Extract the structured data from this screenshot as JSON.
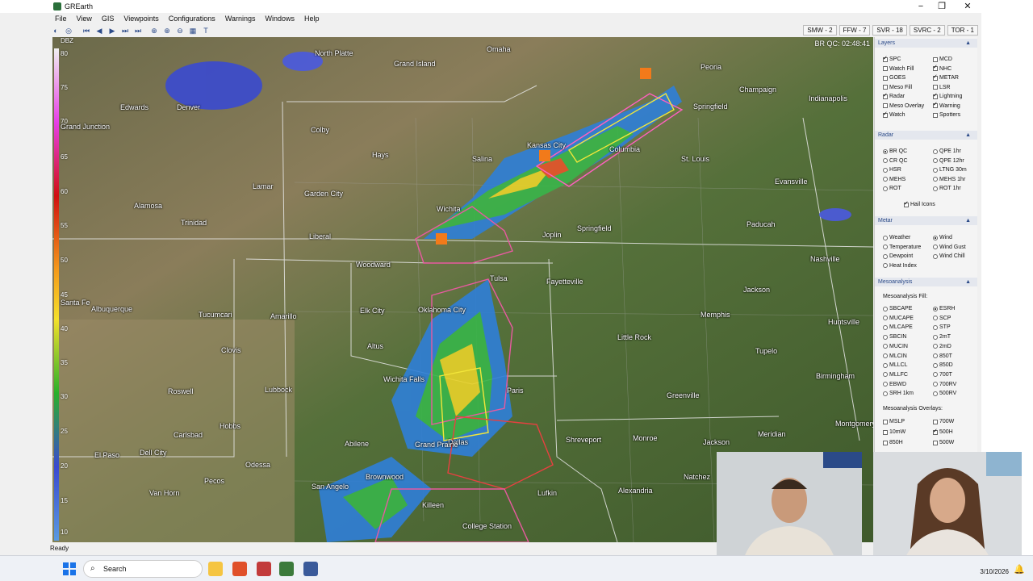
{
  "window": {
    "title": "GREarth",
    "minimize": "−",
    "maximize": "❐",
    "close": "✕"
  },
  "menu": [
    "File",
    "View",
    "GIS",
    "Viewpoints",
    "Configurations",
    "Warnings",
    "Windows",
    "Help"
  ],
  "toolbar": {
    "icons": [
      "globe-icon",
      "gps-icon",
      "first-frame-icon",
      "prev-frame-icon",
      "play-icon",
      "next-frame-icon",
      "last-frame-icon",
      "zoom-fit-icon",
      "zoom-in-icon",
      "zoom-out-icon",
      "grid-icon",
      "text-icon"
    ]
  },
  "warning_counts": [
    "SMW - 2",
    "FFW - 7",
    "SVR - 18",
    "SVRC - 2",
    "TOR - 1"
  ],
  "map": {
    "readout": "BR QC: 02:48:41",
    "scale_label": "DBZ",
    "scale_ticks": [
      "80",
      "75",
      "70",
      "65",
      "60",
      "55",
      "50",
      "45",
      "40",
      "35",
      "30",
      "25",
      "20",
      "15",
      "10"
    ],
    "cities": [
      "North Platte",
      "Grand Island",
      "Omaha",
      "Peoria",
      "Champaign",
      "Indianapolis",
      "Springfield",
      "Edwards",
      "Denver",
      "Grand Junction",
      "Colby",
      "Hays",
      "Salina",
      "Kansas City",
      "Columbia",
      "St. Louis",
      "Evansville",
      "Lamar",
      "Garden City",
      "Wichita",
      "Joplin",
      "Springfield",
      "Paducah",
      "Alamosa",
      "Trinidad",
      "Liberal",
      "Woodward",
      "Tulsa",
      "Fayetteville",
      "Nashville",
      "Jackson",
      "Santa Fe",
      "Albuquerque",
      "Tucumcari",
      "Amarillo",
      "Elk City",
      "Oklahoma City",
      "Memphis",
      "Little Rock",
      "Huntsville",
      "Clovis",
      "Altus",
      "Wichita Falls",
      "Paris",
      "Tupelo",
      "Birmingham",
      "Roswell",
      "Lubbock",
      "Hobbs",
      "Greenville",
      "Carlsbad",
      "Abilene",
      "Dallas",
      "Shreveport",
      "Monroe",
      "Jackson",
      "Meridian",
      "Montgomery",
      "El Paso",
      "Dell City",
      "Odessa",
      "Brownwood",
      "Grand Prairie",
      "Pecos",
      "San Angelo",
      "Killeen",
      "Lufkin",
      "Alexandria",
      "Natchez",
      "Van Horn",
      "College Station"
    ]
  },
  "panel": {
    "layers": {
      "title": "Layers",
      "items": [
        {
          "label": "SPC",
          "on": true
        },
        {
          "label": "MCD",
          "on": false
        },
        {
          "label": "Watch Fill",
          "on": false
        },
        {
          "label": "NHC",
          "on": true
        },
        {
          "label": "GOES",
          "on": false
        },
        {
          "label": "METAR",
          "on": true
        },
        {
          "label": "Meso Fill",
          "on": false
        },
        {
          "label": "LSR",
          "on": false
        },
        {
          "label": "Radar",
          "on": true
        },
        {
          "label": "Lightning",
          "on": true
        },
        {
          "label": "Meso Overlay",
          "on": false
        },
        {
          "label": "Warning",
          "on": true
        },
        {
          "label": "Watch",
          "on": true
        },
        {
          "label": "Spotters",
          "on": false
        }
      ]
    },
    "radar": {
      "title": "Radar",
      "items": [
        {
          "label": "BR QC",
          "on": true
        },
        {
          "label": "QPE 1hr",
          "on": false
        },
        {
          "label": "CR QC",
          "on": false
        },
        {
          "label": "QPE 12hr",
          "on": false
        },
        {
          "label": "HSR",
          "on": false
        },
        {
          "label": "LTNG 30m",
          "on": false
        },
        {
          "label": "MEHS",
          "on": false
        },
        {
          "label": "MEHS 1hr",
          "on": false
        },
        {
          "label": "ROT",
          "on": false
        },
        {
          "label": "ROT 1hr",
          "on": false
        }
      ],
      "hail_icons": "Hail Icons"
    },
    "metar": {
      "title": "Metar",
      "items": [
        {
          "label": "Weather",
          "on": false
        },
        {
          "label": "Wind",
          "on": true
        },
        {
          "label": "Temperature",
          "on": false
        },
        {
          "label": "Wind Gust",
          "on": false
        },
        {
          "label": "Dewpoint",
          "on": false
        },
        {
          "label": "Wind Chill",
          "on": false
        },
        {
          "label": "Heat Index",
          "on": false
        }
      ]
    },
    "meso": {
      "title": "Mesoanalysis",
      "fill_title": "Mesoanalysis Fill:",
      "items": [
        {
          "label": "SBCAPE",
          "on": false
        },
        {
          "label": "ESRH",
          "on": true
        },
        {
          "label": "MUCAPE",
          "on": false
        },
        {
          "label": "SCP",
          "on": false
        },
        {
          "label": "MLCAPE",
          "on": false
        },
        {
          "label": "STP",
          "on": false
        },
        {
          "label": "SBCIN",
          "on": false
        },
        {
          "label": "2mT",
          "on": false
        },
        {
          "label": "MUCIN",
          "on": false
        },
        {
          "label": "2mD",
          "on": false
        },
        {
          "label": "MLCIN",
          "on": false
        },
        {
          "label": "850T",
          "on": false
        },
        {
          "label": "MLLCL",
          "on": false
        },
        {
          "label": "850D",
          "on": false
        },
        {
          "label": "MLLFC",
          "on": false
        },
        {
          "label": "700T",
          "on": false
        },
        {
          "label": "EBWD",
          "on": false
        },
        {
          "label": "700RV",
          "on": false
        },
        {
          "label": "SRH 1km",
          "on": false
        },
        {
          "label": "500RV",
          "on": false
        }
      ],
      "overlays_title": "Mesoanalysis Overlays:",
      "overlays": [
        {
          "label": "MSLP",
          "on": false
        },
        {
          "label": "700W",
          "on": false
        },
        {
          "label": "10mW",
          "on": false
        },
        {
          "label": "500H",
          "on": true
        },
        {
          "label": "850H",
          "on": false
        },
        {
          "label": "500W",
          "on": false
        }
      ]
    }
  },
  "status": "Ready",
  "taskbar": {
    "search": "Search",
    "date": "3/10/2026"
  },
  "colors": {
    "map_bg": "#5b6a3c",
    "panel_header": "#e4e7ee",
    "accent": "#2b4a88"
  }
}
